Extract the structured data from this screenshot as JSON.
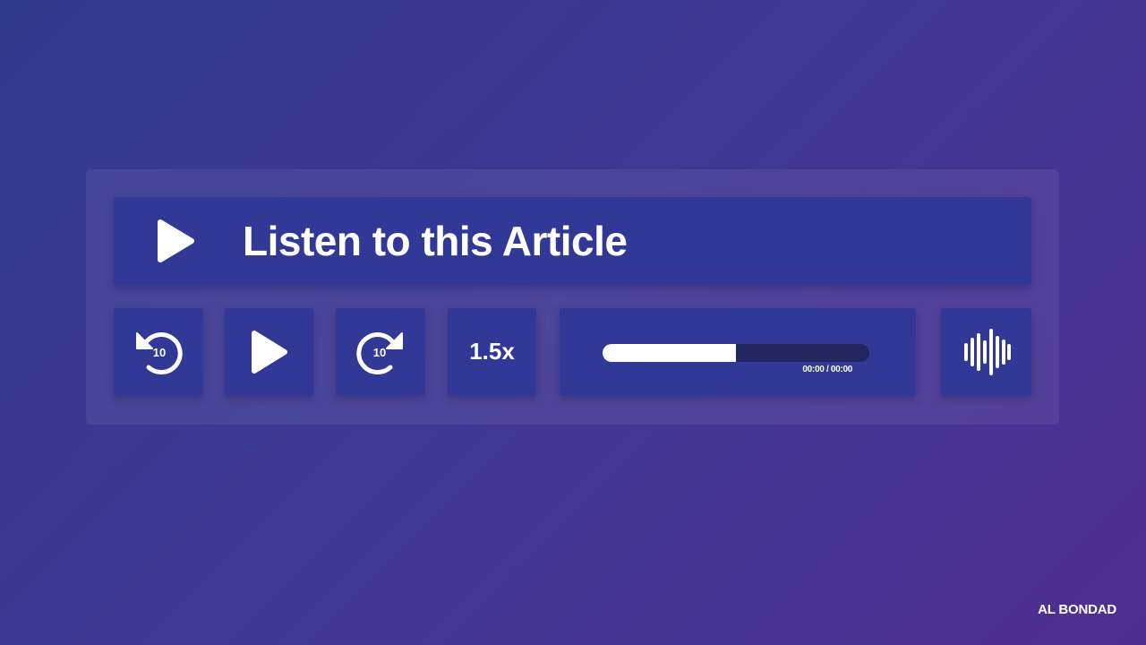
{
  "player": {
    "title": "Listen to this Article",
    "controls": {
      "rewind_seconds": "10",
      "forward_seconds": "10",
      "speed": "1.5x"
    },
    "progress": {
      "fraction": 0.5,
      "time_display": "00:00 / 00:00"
    }
  },
  "brand": {
    "name": "AL BONDAD"
  },
  "colors": {
    "background_start": "#323a8e",
    "background_end": "#4d2f92",
    "card": "#323895",
    "progress_track": "#222660",
    "foreground": "#ffffff"
  },
  "icons": {
    "title_play": "play-icon",
    "rewind": "rewind-10-icon",
    "play": "play-icon",
    "forward": "forward-10-icon",
    "audio": "sound-wave-icon"
  }
}
